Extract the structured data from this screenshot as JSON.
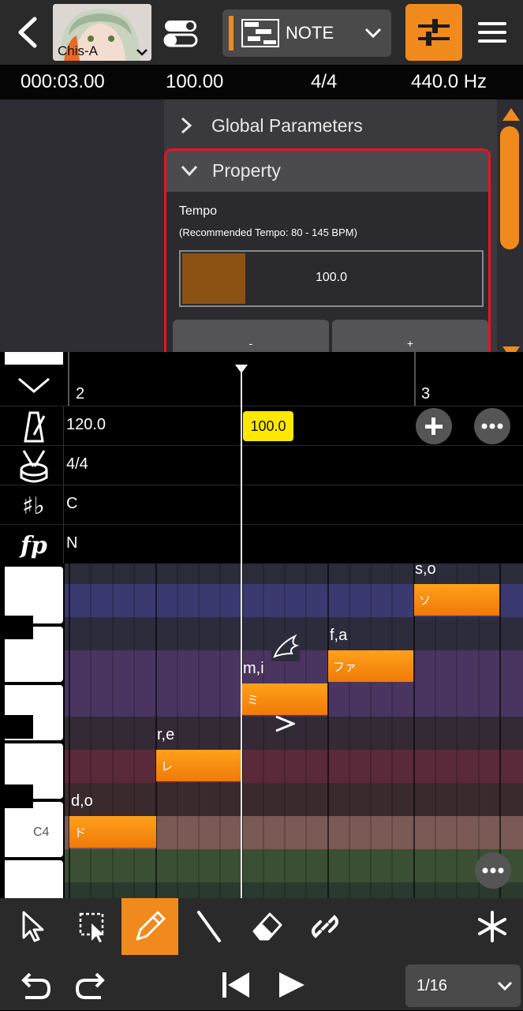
{
  "header": {
    "singer_name": "Chis-A",
    "mode_label": "NOTE"
  },
  "status": {
    "time": "000:03.00",
    "tempo": "100.00",
    "beat": "4/4",
    "pitch": "440.0 Hz"
  },
  "panel": {
    "global_params_label": "Global Parameters",
    "property_label": "Property",
    "tempo_label": "Tempo",
    "tempo_recommended": "(Recommended Tempo: 80 - 145 BPM)",
    "tempo_value": "100.0",
    "tempo_fill_fraction": 0.21,
    "minus_label": "-",
    "plus_label": "+"
  },
  "ruler": {
    "bar_2": "2",
    "bar_3": "3"
  },
  "tracks": {
    "tempo_value": "120.0",
    "tempo_marker": "100.0",
    "beat_value": "4/4",
    "key_value": "C",
    "dynamics_value": "N"
  },
  "piano": {
    "c4_label": "C4"
  },
  "notes": [
    {
      "lyric": "d,o",
      "text": "ド"
    },
    {
      "lyric": "r,e",
      "text": "レ"
    },
    {
      "lyric": "m,i",
      "text": "ミ"
    },
    {
      "lyric": "f,a",
      "text": "ファ"
    },
    {
      "lyric": "s,o",
      "text": "ソ"
    }
  ],
  "quantize": {
    "label": "1/16"
  },
  "colors": {
    "accent": "#f08a1c",
    "highlight_border": "#e8141e",
    "tempo_marker_bg": "#ffe800"
  }
}
